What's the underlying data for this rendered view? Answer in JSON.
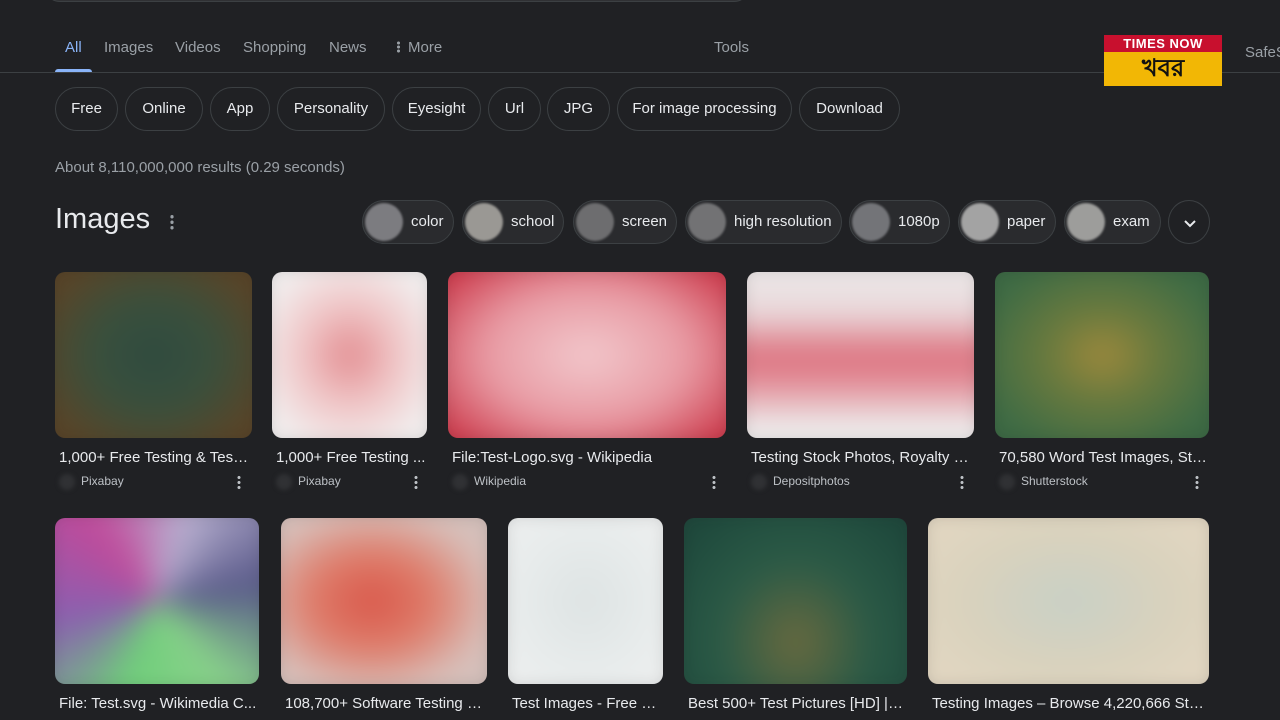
{
  "tabs": [
    {
      "label": "All",
      "active": true
    },
    {
      "label": "Images",
      "active": false
    },
    {
      "label": "Videos",
      "active": false
    },
    {
      "label": "Shopping",
      "active": false
    },
    {
      "label": "News",
      "active": false
    },
    {
      "label": "More",
      "active": false,
      "icon": "more-vert-icon"
    }
  ],
  "tools_label": "Tools",
  "safesearch_label": "SafeS",
  "brand": {
    "top": "TIMES NOW",
    "bottom": "খবর",
    "colors": {
      "top": "#c8102e",
      "bottom": "#f2b705"
    }
  },
  "filter_chips": [
    "Free",
    "Online",
    "App",
    "Personality",
    "Eyesight",
    "Url",
    "JPG",
    "For image processing",
    "Download"
  ],
  "results_stats": "About 8,110,000,000 results (0.29 seconds)",
  "images_section": {
    "title": "Images",
    "refinements": [
      "color",
      "school",
      "screen",
      "high resolution",
      "1080p",
      "paper",
      "exam"
    ],
    "expand_icon": "chevron-down-icon"
  },
  "image_results": [
    {
      "caption": "1,000+ Free Testing & Test ...",
      "source": "Pixabay"
    },
    {
      "caption": "1,000+ Free Testing ...",
      "source": "Pixabay"
    },
    {
      "caption": "File:Test-Logo.svg - Wikipedia",
      "source": "Wikipedia"
    },
    {
      "caption": "Testing Stock Photos, Royalty F...",
      "source": "Depositphotos"
    },
    {
      "caption": "70,580 Word Test Images, Sto...",
      "source": "Shutterstock"
    },
    {
      "caption": "File: Test.svg - Wikimedia C...",
      "source": ""
    },
    {
      "caption": "108,700+ Software Testing S...",
      "source": ""
    },
    {
      "caption": "Test Images - Free D...",
      "source": ""
    },
    {
      "caption": "Best 500+ Test Pictures [HD] | ...",
      "source": ""
    },
    {
      "caption": "Testing Images – Browse 4,220,666 Sto...",
      "source": ""
    }
  ],
  "colors": {
    "background": "#202124",
    "accent": "#8ab4f8",
    "text": "#e8eaed",
    "muted": "#9aa0a6"
  }
}
